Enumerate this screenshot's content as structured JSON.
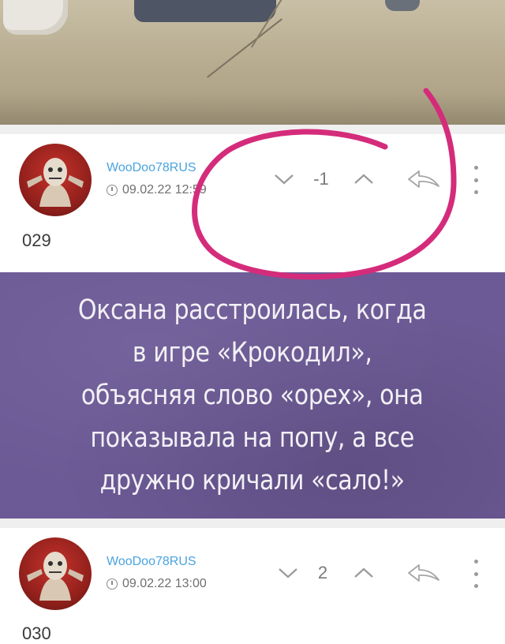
{
  "comments": [
    {
      "username": "WooDoo78RUS",
      "date": "09.02.22 12:59",
      "score": "-1",
      "number": "029"
    },
    {
      "username": "WooDoo78RUS",
      "date": "09.02.22 13:00",
      "score": "2",
      "number": "030"
    }
  ],
  "meme": {
    "text": "Оксана расстроилась, когда\nв игре «Крокодил»,\nобъясняя слово «орех», она\nпоказывала на попу, а все\nдружно кричали «сало!»",
    "background": "#6c5a96"
  },
  "icons": {
    "downvote": "chevron-down-icon",
    "upvote": "chevron-up-icon",
    "reply": "reply-arrow-icon",
    "menu": "more-vertical-icon",
    "time": "clock-icon"
  },
  "colors": {
    "username": "#4aa3df",
    "annotation": "#d42c7b"
  }
}
